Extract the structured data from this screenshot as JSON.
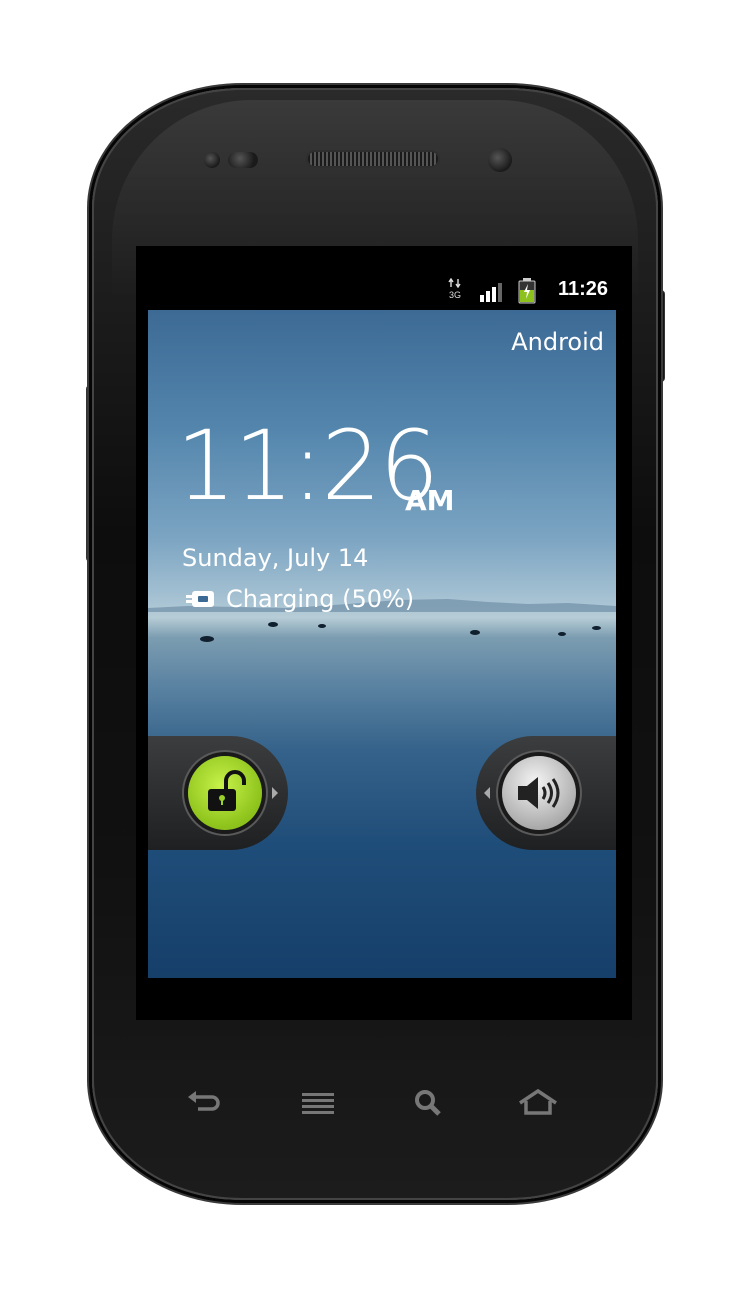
{
  "statusbar": {
    "time": "11:26",
    "network_type": "3G",
    "icons": [
      "data-arrows-icon",
      "signal-bars-icon",
      "battery-charging-icon"
    ]
  },
  "lockscreen": {
    "carrier": "Android",
    "clock": "11:26",
    "ampm": "AM",
    "date": "Sunday, July 14",
    "charging": "Charging (50%)",
    "unlock_icon": "unlock-padlock-icon",
    "sound_icon": "speaker-volume-icon",
    "colors": {
      "unlock_accent": "#8cc21b",
      "sound_accent": "#c8c8c8"
    }
  },
  "softkeys": [
    "back-icon",
    "menu-icon",
    "search-icon",
    "home-icon"
  ]
}
